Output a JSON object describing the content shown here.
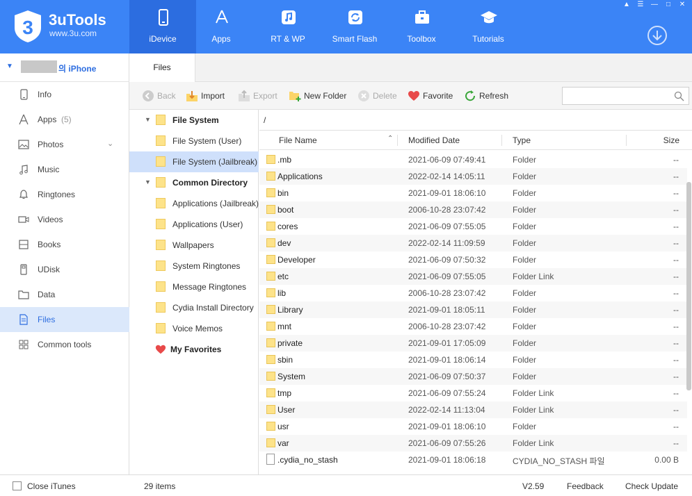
{
  "app": {
    "name": "3uTools",
    "url": "www.3u.com"
  },
  "nav": [
    {
      "label": "iDevice",
      "icon": "phone-icon"
    },
    {
      "label": "Apps",
      "icon": "apps-icon"
    },
    {
      "label": "RT & WP",
      "icon": "music-note-icon"
    },
    {
      "label": "Smart Flash",
      "icon": "flash-icon"
    },
    {
      "label": "Toolbox",
      "icon": "toolbox-icon"
    },
    {
      "label": "Tutorials",
      "icon": "graduation-cap-icon"
    }
  ],
  "device": {
    "name": "의 iPhone"
  },
  "sidebar": [
    {
      "label": "Info",
      "icon": "info-phone-icon"
    },
    {
      "label": "Apps",
      "count": "(5)",
      "icon": "apps-icon"
    },
    {
      "label": "Photos",
      "icon": "photos-icon"
    },
    {
      "label": "Music",
      "icon": "music-icon"
    },
    {
      "label": "Ringtones",
      "icon": "bell-icon"
    },
    {
      "label": "Videos",
      "icon": "video-icon"
    },
    {
      "label": "Books",
      "icon": "book-icon"
    },
    {
      "label": "UDisk",
      "icon": "udisk-icon"
    },
    {
      "label": "Data",
      "icon": "folder-icon"
    },
    {
      "label": "Files",
      "icon": "file-icon"
    },
    {
      "label": "Common tools",
      "icon": "grid-icon"
    }
  ],
  "tab": {
    "label": "Files"
  },
  "toolbar": {
    "back": "Back",
    "import": "Import",
    "export": "Export",
    "new_folder": "New Folder",
    "delete": "Delete",
    "favorite": "Favorite",
    "refresh": "Refresh"
  },
  "tree": [
    {
      "label": "File System",
      "bold": true,
      "level": 0
    },
    {
      "label": "File System (User)",
      "level": 1
    },
    {
      "label": "File System (Jailbreak)",
      "level": 1,
      "selected": true
    },
    {
      "label": "Common Directory",
      "bold": true,
      "level": 0
    },
    {
      "label": "Applications (Jailbreak)",
      "level": 1
    },
    {
      "label": "Applications (User)",
      "level": 1
    },
    {
      "label": "Wallpapers",
      "level": 1
    },
    {
      "label": "System Ringtones",
      "level": 1
    },
    {
      "label": "Message Ringtones",
      "level": 1
    },
    {
      "label": "Cydia Install Directory",
      "level": 1
    },
    {
      "label": "Voice Memos",
      "level": 1
    },
    {
      "label": "My Favorites",
      "bold": true,
      "level": 0,
      "heart": true
    }
  ],
  "path": "/",
  "columns": {
    "name": "File Name",
    "date": "Modified Date",
    "type": "Type",
    "size": "Size"
  },
  "files": [
    {
      "name": ".mb",
      "date": "2021-06-09 07:49:41",
      "type": "Folder",
      "size": "--"
    },
    {
      "name": "Applications",
      "date": "2022-02-14 14:05:11",
      "type": "Folder",
      "size": "--"
    },
    {
      "name": "bin",
      "date": "2021-09-01 18:06:10",
      "type": "Folder",
      "size": "--"
    },
    {
      "name": "boot",
      "date": "2006-10-28 23:07:42",
      "type": "Folder",
      "size": "--"
    },
    {
      "name": "cores",
      "date": "2021-06-09 07:55:05",
      "type": "Folder",
      "size": "--"
    },
    {
      "name": "dev",
      "date": "2022-02-14 11:09:59",
      "type": "Folder",
      "size": "--"
    },
    {
      "name": "Developer",
      "date": "2021-06-09 07:50:32",
      "type": "Folder",
      "size": "--"
    },
    {
      "name": "etc",
      "date": "2021-06-09 07:55:05",
      "type": "Folder Link",
      "size": "--"
    },
    {
      "name": "lib",
      "date": "2006-10-28 23:07:42",
      "type": "Folder",
      "size": "--"
    },
    {
      "name": "Library",
      "date": "2021-09-01 18:05:11",
      "type": "Folder",
      "size": "--"
    },
    {
      "name": "mnt",
      "date": "2006-10-28 23:07:42",
      "type": "Folder",
      "size": "--"
    },
    {
      "name": "private",
      "date": "2021-09-01 17:05:09",
      "type": "Folder",
      "size": "--"
    },
    {
      "name": "sbin",
      "date": "2021-09-01 18:06:14",
      "type": "Folder",
      "size": "--"
    },
    {
      "name": "System",
      "date": "2021-06-09 07:50:37",
      "type": "Folder",
      "size": "--"
    },
    {
      "name": "tmp",
      "date": "2021-06-09 07:55:24",
      "type": "Folder Link",
      "size": "--"
    },
    {
      "name": "User",
      "date": "2022-02-14 11:13:04",
      "type": "Folder Link",
      "size": "--"
    },
    {
      "name": "usr",
      "date": "2021-09-01 18:06:10",
      "type": "Folder",
      "size": "--"
    },
    {
      "name": "var",
      "date": "2021-06-09 07:55:26",
      "type": "Folder Link",
      "size": "--"
    },
    {
      "name": ".cydia_no_stash",
      "date": "2021-09-01 18:06:18",
      "type": "CYDIA_NO_STASH 파일",
      "size": "0.00 B",
      "file": true
    }
  ],
  "status": {
    "close_itunes": "Close iTunes",
    "items": "29 items",
    "version": "V2.59",
    "feedback": "Feedback",
    "check_update": "Check Update"
  },
  "colors": {
    "header": "#3b84f6",
    "header_active": "#2c6de0",
    "selected": "#cfe0fb",
    "folder": "#fde38a"
  }
}
